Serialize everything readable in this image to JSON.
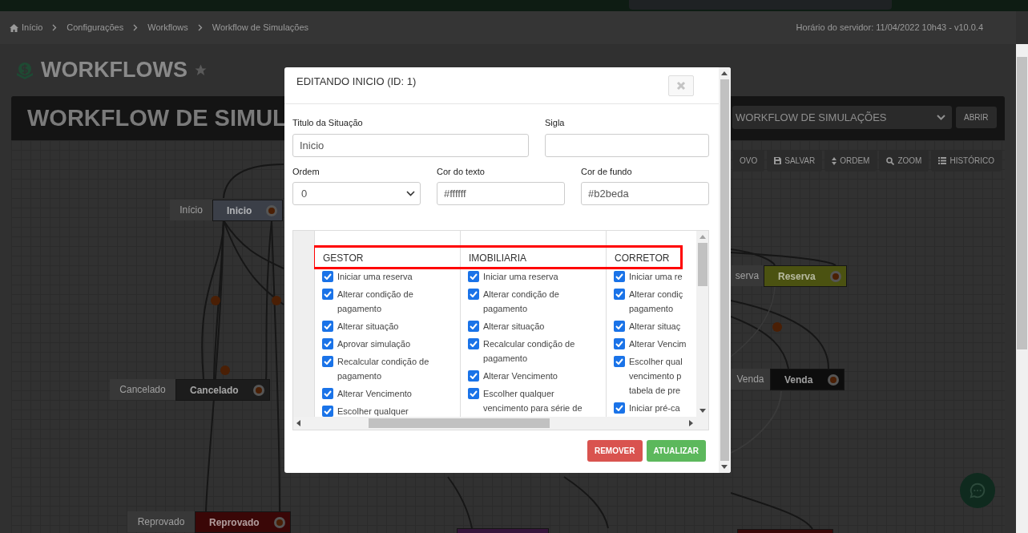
{
  "breadcrumb": {
    "items": [
      {
        "label": "Início",
        "kind": "home"
      },
      {
        "label": "Configurações"
      },
      {
        "label": "Workflows"
      },
      {
        "label": "Workflow de Simulações"
      }
    ],
    "server_info": "Horário do servidor: 11/04/2022 10h43 - v10.0.4"
  },
  "page_title": "WORKFLOWS",
  "workflow_header": {
    "title": "WORKFLOW DE SIMUL",
    "select_value": "WORKFLOW DE SIMULAÇÕES",
    "open_button": "ABRIR"
  },
  "toolbar": [
    {
      "label": "OVO",
      "kind": "plain"
    },
    {
      "label": "SALVAR",
      "kind": "save"
    },
    {
      "label": "ORDEM",
      "kind": "sort"
    },
    {
      "label": "ZOOM",
      "kind": "zoom"
    },
    {
      "label": "HISTÓRICO",
      "kind": "history"
    }
  ],
  "canvas": {
    "nodes": [
      {
        "label": "Início",
        "title": "Inicio",
        "color": "#3b3f48"
      },
      {
        "label": "Cancelado",
        "title": "Cancelado",
        "color": "#1c1c1c"
      },
      {
        "label": "Reprovado",
        "title": "Reprovado",
        "color": "#3a0707"
      },
      {
        "label": "serva",
        "title": "Reserva",
        "color": "#4b5211"
      },
      {
        "label": "Venda",
        "title": "Venda",
        "color": "#0d0d0d"
      },
      {
        "color": "#35163b"
      },
      {
        "color": "#3a0707"
      }
    ]
  },
  "dialog": {
    "title": "EDITANDO INICIO (ID: 1)",
    "fields": [
      {
        "label": "Titulo da Situação",
        "value": "Inicio",
        "kind": "text"
      },
      {
        "label": "Sigla",
        "kind": "text"
      },
      {
        "label": "Ordem",
        "value": "0",
        "kind": "select"
      },
      {
        "label": "Cor do texto",
        "value": "#ffffff",
        "kind": "text"
      },
      {
        "label": "Cor de fundo",
        "value": "#b2beda",
        "kind": "text"
      }
    ],
    "permissions": {
      "columns": [
        {
          "heading": "GESTOR",
          "items": [
            {
              "lines": [
                "Iniciar uma reserva"
              ],
              "checked": true
            },
            {
              "lines": [
                "Alterar condição de",
                "pagamento"
              ],
              "checked": true
            },
            {
              "lines": [
                "Alterar situação"
              ],
              "checked": true
            },
            {
              "lines": [
                "Aprovar simulação"
              ],
              "checked": true
            },
            {
              "lines": [
                "Recalcular condição de",
                "pagamento"
              ],
              "checked": true
            },
            {
              "lines": [
                "Alterar Vencimento"
              ],
              "checked": true
            },
            {
              "lines": [
                "Escolher qualquer"
              ],
              "checked": true
            }
          ]
        },
        {
          "heading": "IMOBILIARIA",
          "items": [
            {
              "lines": [
                "Iniciar uma reserva"
              ],
              "checked": true
            },
            {
              "lines": [
                "Alterar condição de",
                "pagamento"
              ],
              "checked": true
            },
            {
              "lines": [
                "Alterar situação"
              ],
              "checked": true
            },
            {
              "lines": [
                "Recalcular condição de",
                "pagamento"
              ],
              "checked": true
            },
            {
              "lines": [
                "Alterar Vencimento"
              ],
              "checked": true
            },
            {
              "lines": [
                "Escolher qualquer",
                "vencimento para série de"
              ],
              "checked": true
            }
          ]
        },
        {
          "heading": "CORRETOR",
          "items": [
            {
              "lines": [
                "Iniciar uma re"
              ],
              "checked": true
            },
            {
              "lines": [
                "Alterar condiç",
                "pagamento"
              ],
              "checked": true
            },
            {
              "lines": [
                "Alterar situaç"
              ],
              "checked": true
            },
            {
              "lines": [
                "Alterar Vencim"
              ],
              "checked": true
            },
            {
              "lines": [
                "Escolher qual",
                "vencimento p",
                "tabela de pre"
              ],
              "checked": true
            },
            {
              "lines": [
                "Iniciar pré-ca"
              ],
              "checked": true
            }
          ]
        }
      ]
    },
    "buttons": [
      {
        "label": "REMOVER",
        "kind": "danger"
      },
      {
        "label": "ATUALIZAR",
        "kind": "success"
      }
    ]
  }
}
